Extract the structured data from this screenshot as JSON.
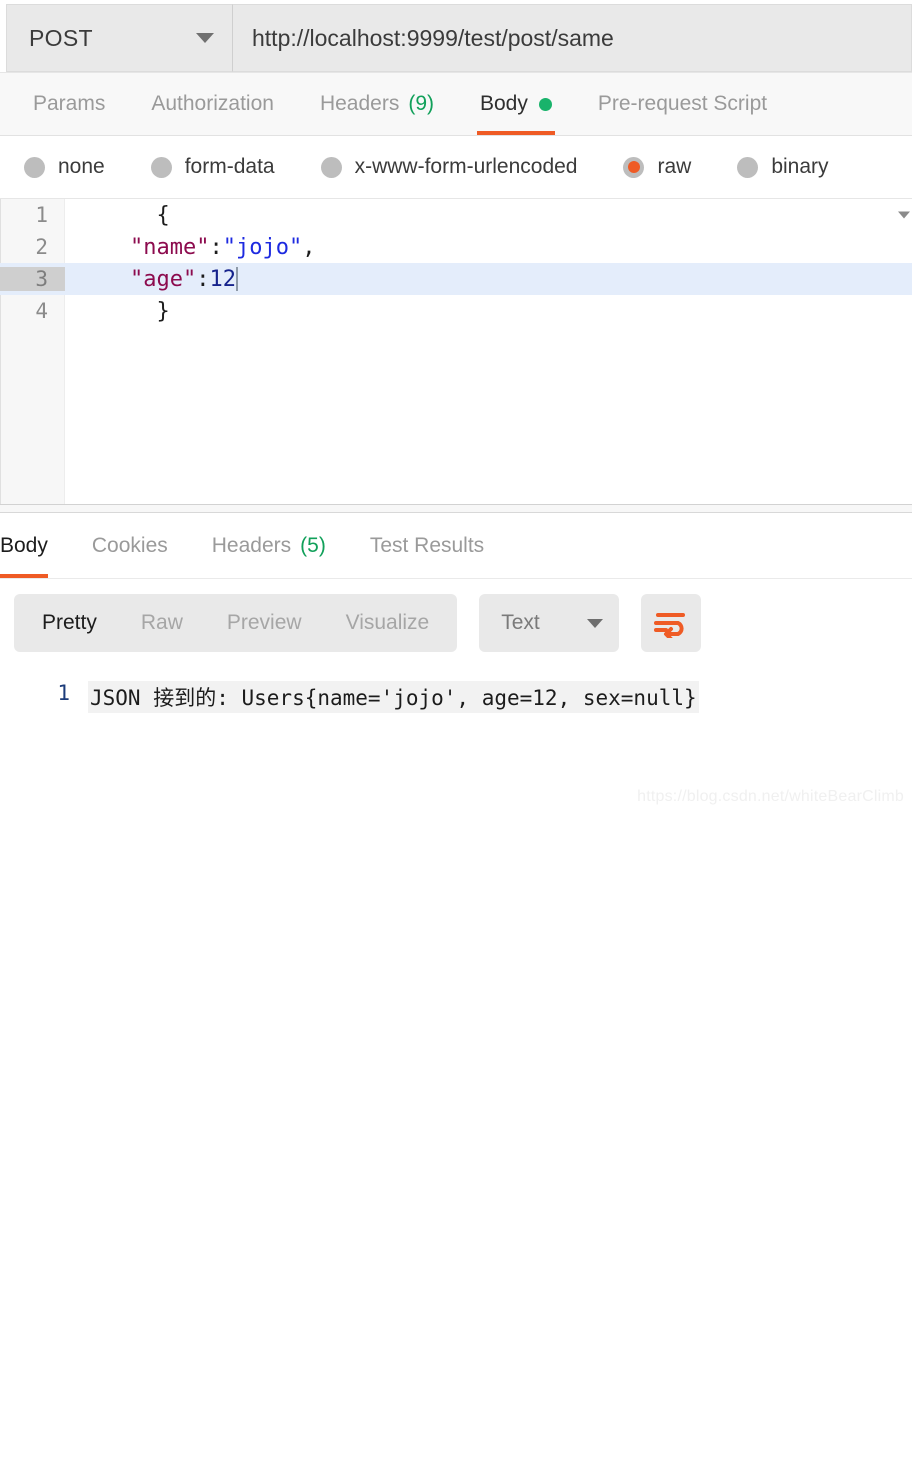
{
  "request": {
    "method": "POST",
    "url": "http://localhost:9999/test/post/same",
    "tabs": [
      {
        "label": "Params",
        "active": false
      },
      {
        "label": "Authorization",
        "active": false
      },
      {
        "label": "Headers",
        "count": "(9)",
        "active": false
      },
      {
        "label": "Body",
        "active": true,
        "dot": true
      },
      {
        "label": "Pre-request Script",
        "active": false
      }
    ],
    "body_types": [
      {
        "label": "none",
        "selected": false
      },
      {
        "label": "form-data",
        "selected": false
      },
      {
        "label": "x-www-form-urlencoded",
        "selected": false
      },
      {
        "label": "raw",
        "selected": true
      },
      {
        "label": "binary",
        "selected": false
      }
    ],
    "editor": {
      "lines": [
        {
          "number": "1",
          "foldable": true,
          "active": false
        },
        {
          "number": "2",
          "foldable": false,
          "active": false
        },
        {
          "number": "3",
          "foldable": false,
          "active": true
        },
        {
          "number": "4",
          "foldable": false,
          "active": false
        }
      ],
      "line1_brace": "{",
      "line2_key": "\"name\"",
      "line2_colon": ":",
      "line2_value": "\"jojo\"",
      "line2_comma": ",",
      "line3_key": "\"age\"",
      "line3_colon": ":",
      "line3_value": "12",
      "line4_brace": "}"
    }
  },
  "response": {
    "tabs": [
      {
        "label": "Body",
        "active": true
      },
      {
        "label": "Cookies",
        "active": false
      },
      {
        "label": "Headers",
        "count": "(5)",
        "active": false
      },
      {
        "label": "Test Results",
        "active": false
      }
    ],
    "view_modes": [
      {
        "label": "Pretty",
        "active": true
      },
      {
        "label": "Raw",
        "active": false
      },
      {
        "label": "Preview",
        "active": false
      },
      {
        "label": "Visualize",
        "active": false
      }
    ],
    "format": "Text",
    "body": {
      "line_number": "1",
      "text": "JSON 接到的: Users{name='jojo', age=12, sex=null}"
    }
  },
  "watermark": "https://blog.csdn.net/whiteBearClimb",
  "colors": {
    "accent_orange": "#ef5b25",
    "green": "#11a05a",
    "json_key": "#8c0b4e",
    "json_string": "#1d2ae0",
    "json_number": "#16238c",
    "active_line": "#e4edfb"
  }
}
